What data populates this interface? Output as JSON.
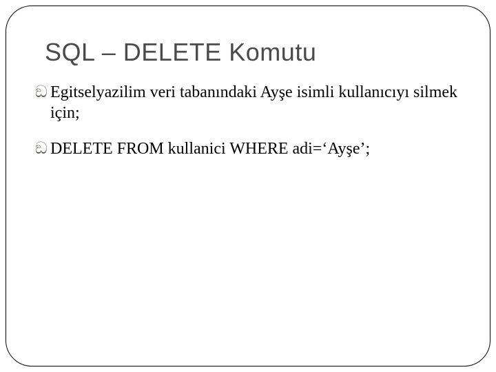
{
  "title": "SQL – DELETE Komutu",
  "bullets": [
    {
      "glyph": "ඞ",
      "text": "Egitselyazilim veri tabanındaki  Ayşe isimli kullanıcıyı silmek için;"
    },
    {
      "glyph": "ඞ",
      "text": "DELETE FROM kullanici WHERE adi=‘Ayşe’;"
    }
  ]
}
